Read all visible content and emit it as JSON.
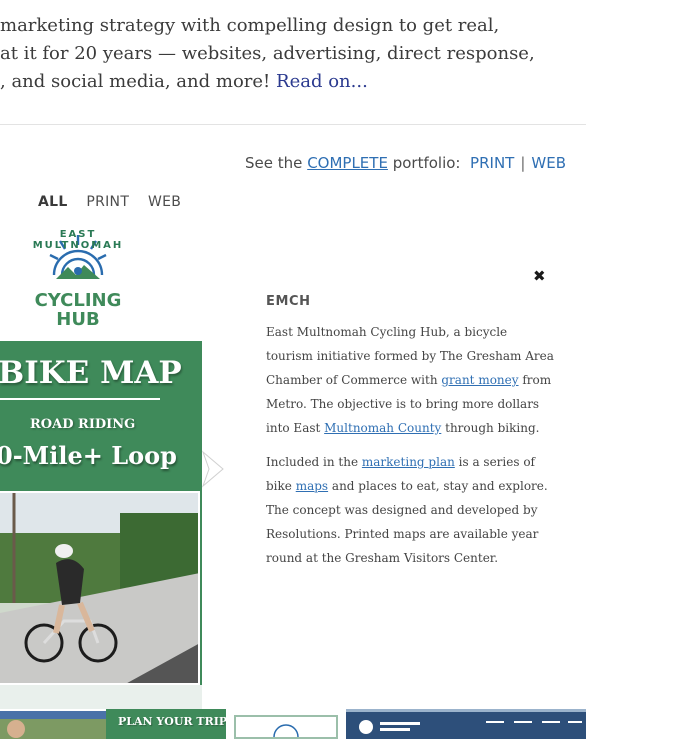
{
  "intro": {
    "lines": [
      "marketing strategy with compelling design to get real,",
      "at it for 20 years — websites, advertising, direct response,",
      ", and social media, and more!"
    ],
    "read_on": "Read on..."
  },
  "portfolio": {
    "prefix": "See the",
    "complete": "COMPLETE",
    "suffix": "portfolio:",
    "print": "PRINT",
    "separator": "|",
    "web": "WEB"
  },
  "filters": [
    "ALL",
    "PRINT",
    "WEB"
  ],
  "preview": {
    "logo_arc": "EAST MULTNOMAH",
    "logo_line1": "CYCLING",
    "logo_line2": "HUB",
    "title": "BIKE MAP",
    "subtitle": "ROAD RIDING",
    "loop": "0-Mile+ Loop"
  },
  "detail": {
    "close": "✖",
    "title": "EMCH",
    "p1_a": "East Multnomah Cycling Hub, a bicycle tourism initiative formed by The Gresham Area Chamber of Commerce with ",
    "p1_link1": "grant money",
    "p1_b": " from Metro. The objective is to bring more dollars into East ",
    "p1_link2": "Multnomah County",
    "p1_c": " through biking.",
    "p2_a": "Included in the ",
    "p2_link1": "marketing plan",
    "p2_b": " is a series of bike ",
    "p2_link2": "maps",
    "p2_c": " and places to eat, stay and explore. The concept was designed and developed by Resolutions. Printed maps are available year round at the Gresham Visitors Center."
  },
  "thumbnails": {
    "plan_trip": "PLAN YOUR TRIP"
  },
  "colors": {
    "brand_green": "#3f8a5a",
    "link_blue": "#2f6fb3",
    "read_on_blue": "#2b3a8f"
  }
}
